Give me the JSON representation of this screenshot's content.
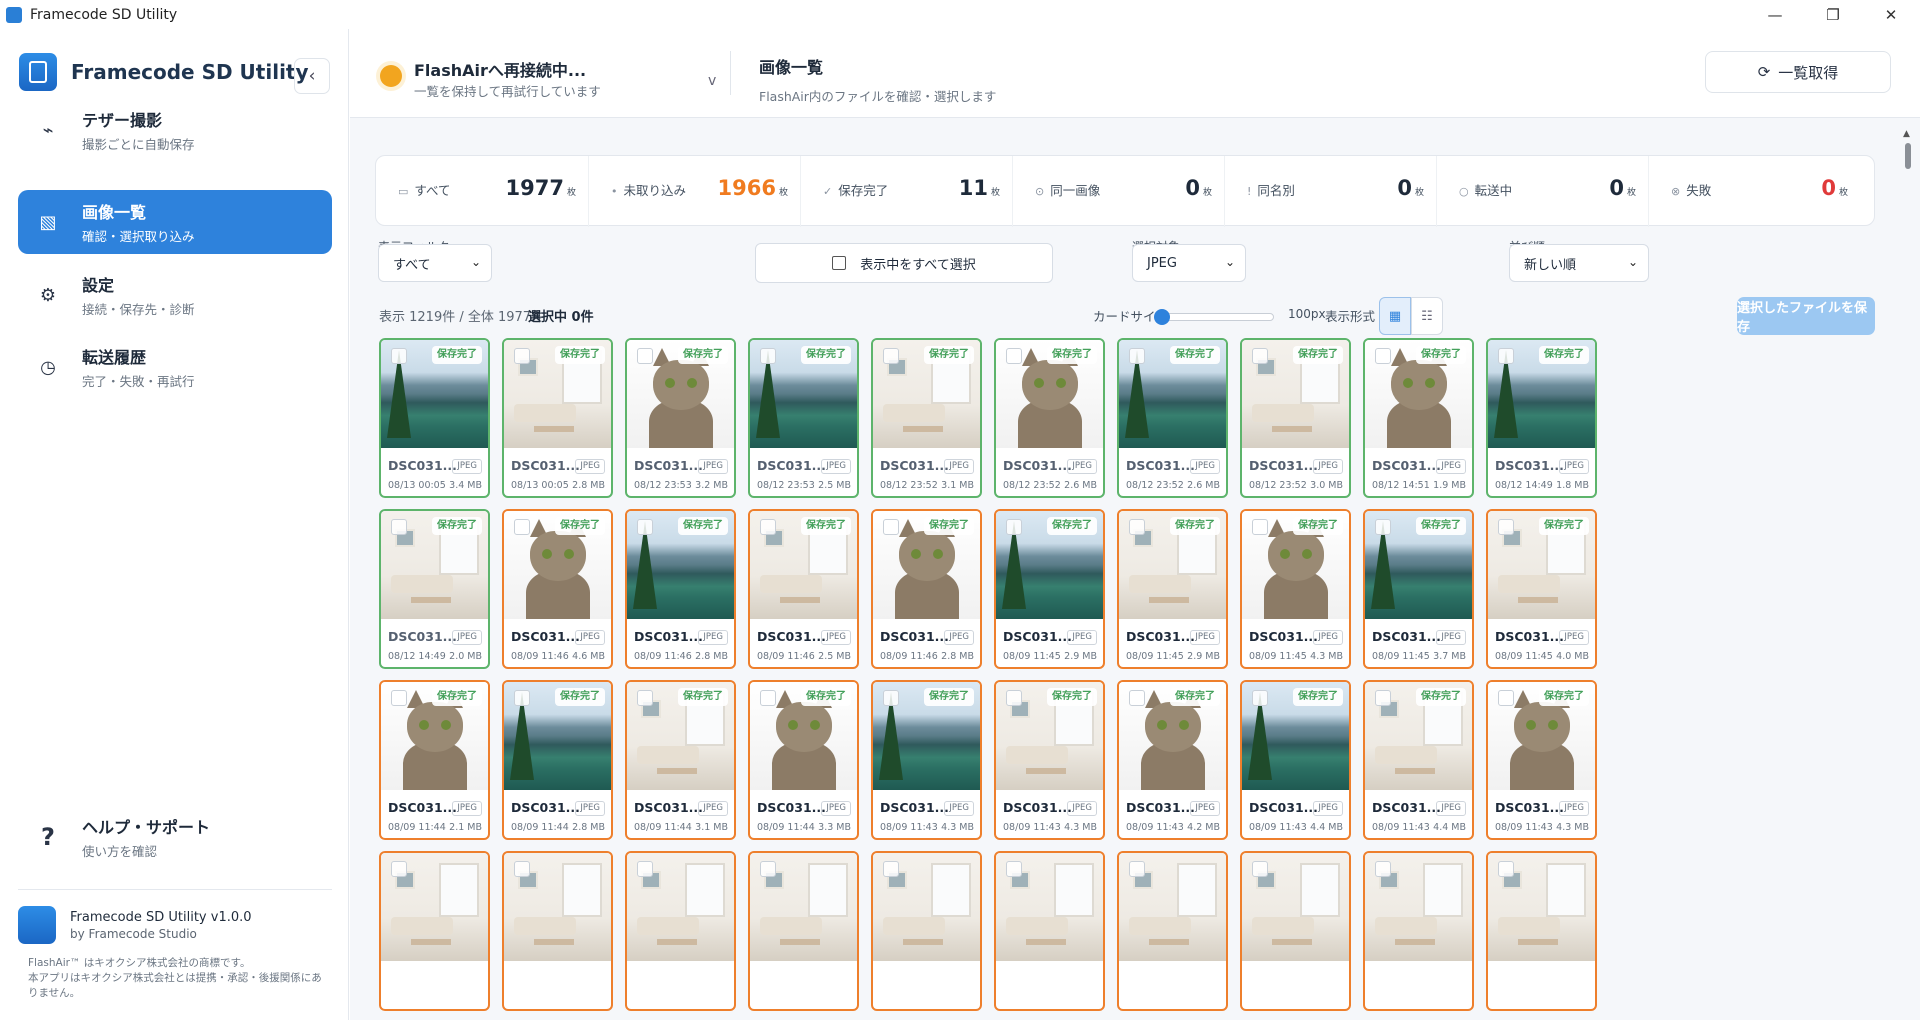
{
  "window": {
    "title": "Framecode SD Utility",
    "controls": [
      "—",
      "❐",
      "✕"
    ]
  },
  "sidebar": {
    "app_name": "Framecode SD Utility",
    "collapse_icon": "‹",
    "nav": [
      {
        "label": "テザー撮影",
        "sub": "撮影ごとに自動保存",
        "icon": "⌁"
      },
      {
        "label": "画像一覧",
        "sub": "確認・選択取り込み",
        "icon": "▧"
      },
      {
        "label": "設定",
        "sub": "接続・保存先・診断",
        "icon": "⚙"
      },
      {
        "label": "転送履歴",
        "sub": "完了・失敗・再試行",
        "icon": "◷"
      }
    ],
    "help": {
      "label": "ヘルプ・サポート",
      "sub": "使い方を確認",
      "icon": "?"
    },
    "footer": {
      "version": "Framecode SD Utility v1.0.0",
      "by": "by Framecode Studio",
      "legal": "FlashAir™ はキオクシア株式会社の商標です。\n本アプリはキオクシア株式会社とは提携・承認・後援関係にありません。"
    }
  },
  "topbar": {
    "conn_title": "FlashAirへ再接続中...",
    "conn_sub": "一覧を保持して再試行しています",
    "conn_chevron": "v",
    "page_title": "画像一覧",
    "page_sub": "FlashAir内のファイルを確認・選択します",
    "refresh_label": "一覧取得",
    "refresh_icon": "⟳"
  },
  "stats": [
    {
      "label": "すべて",
      "icon": "▭",
      "value": "1977",
      "unit": "枚",
      "color": "dark"
    },
    {
      "label": "未取り込み",
      "icon": "•",
      "value": "1966",
      "unit": "枚",
      "color": "orange"
    },
    {
      "label": "保存完了",
      "icon": "✓",
      "value": "11",
      "unit": "枚",
      "color": "dark"
    },
    {
      "label": "同一画像",
      "icon": "⊙",
      "value": "0",
      "unit": "枚",
      "color": "dark"
    },
    {
      "label": "同名別",
      "icon": "!",
      "value": "0",
      "unit": "枚",
      "color": "dark"
    },
    {
      "label": "転送中",
      "icon": "○",
      "value": "0",
      "unit": "枚",
      "color": "dark"
    },
    {
      "label": "失敗",
      "icon": "⊗",
      "value": "0",
      "unit": "枚",
      "color": "red"
    }
  ],
  "filters": {
    "display_filter_label": "表示フィルター",
    "display_filter_value": "すべて",
    "select_all_label": "表示中をすべて選択",
    "target_label": "選択対象",
    "target_value": "JPEG",
    "sort_label": "並び順",
    "sort_value": "新しい順"
  },
  "info": {
    "count": "表示 1219件 / 全体 1977件",
    "selected": "選択中 0件",
    "card_size_label": "カードサイズ",
    "card_size_value": 0.0,
    "card_size_px": "100px",
    "view_mode_label": "表示形式",
    "grid_icon": "▦",
    "list_icon": "☷",
    "save_button": "選択したファイルを保存"
  },
  "cards": [
    {
      "img": "mountain",
      "status": "green",
      "badge": "保存完了",
      "name": "DSC031...",
      "type": "JPEG",
      "date": "08/13 00:05",
      "size": "3.4 MB"
    },
    {
      "img": "room",
      "status": "green",
      "badge": "保存完了",
      "name": "DSC031...",
      "type": "JPEG",
      "date": "08/13 00:05",
      "size": "2.8 MB"
    },
    {
      "img": "cat",
      "status": "green",
      "badge": "保存完了",
      "name": "DSC031...",
      "type": "JPEG",
      "date": "08/12 23:53",
      "size": "3.2 MB"
    },
    {
      "img": "mountain",
      "status": "green",
      "badge": "保存完了",
      "name": "DSC031...",
      "type": "JPEG",
      "date": "08/12 23:53",
      "size": "2.5 MB"
    },
    {
      "img": "room",
      "status": "green",
      "badge": "保存完了",
      "name": "DSC031...",
      "type": "JPEG",
      "date": "08/12 23:52",
      "size": "3.1 MB"
    },
    {
      "img": "cat",
      "status": "green",
      "badge": "保存完了",
      "name": "DSC031...",
      "type": "JPEG",
      "date": "08/12 23:52",
      "size": "2.6 MB"
    },
    {
      "img": "mountain",
      "status": "green",
      "badge": "保存完了",
      "name": "DSC031...",
      "type": "JPEG",
      "date": "08/12 23:52",
      "size": "2.6 MB"
    },
    {
      "img": "room",
      "status": "green",
      "badge": "保存完了",
      "name": "DSC031...",
      "type": "JPEG",
      "date": "08/12 23:52",
      "size": "3.0 MB"
    },
    {
      "img": "cat",
      "status": "green",
      "badge": "保存完了",
      "name": "DSC031...",
      "type": "JPEG",
      "date": "08/12 14:51",
      "size": "1.9 MB"
    },
    {
      "img": "mountain",
      "status": "green",
      "badge": "保存完了",
      "name": "DSC031...",
      "type": "JPEG",
      "date": "08/12 14:49",
      "size": "1.8 MB"
    },
    {
      "img": "room",
      "status": "green",
      "badge": "保存完了",
      "name": "DSC031...",
      "type": "JPEG",
      "date": "08/12 14:49",
      "size": "2.0 MB"
    },
    {
      "img": "cat",
      "status": "orange",
      "badge": "保存完了",
      "name": "DSC031...",
      "type": "JPEG",
      "date": "08/09 11:46",
      "size": "4.6 MB"
    },
    {
      "img": "mountain",
      "status": "orange",
      "badge": "保存完了",
      "name": "DSC031...",
      "type": "JPEG",
      "date": "08/09 11:46",
      "size": "2.8 MB"
    },
    {
      "img": "room",
      "status": "orange",
      "badge": "保存完了",
      "name": "DSC031...",
      "type": "JPEG",
      "date": "08/09 11:46",
      "size": "2.5 MB"
    },
    {
      "img": "cat",
      "status": "orange",
      "badge": "保存完了",
      "name": "DSC031...",
      "type": "JPEG",
      "date": "08/09 11:46",
      "size": "2.8 MB"
    },
    {
      "img": "mountain",
      "status": "orange",
      "badge": "保存完了",
      "name": "DSC031...",
      "type": "JPEG",
      "date": "08/09 11:45",
      "size": "2.9 MB"
    },
    {
      "img": "room",
      "status": "orange",
      "badge": "保存完了",
      "name": "DSC031...",
      "type": "JPEG",
      "date": "08/09 11:45",
      "size": "2.9 MB"
    },
    {
      "img": "cat",
      "status": "orange",
      "badge": "保存完了",
      "name": "DSC031...",
      "type": "JPEG",
      "date": "08/09 11:45",
      "size": "4.3 MB"
    },
    {
      "img": "mountain",
      "status": "orange",
      "badge": "保存完了",
      "name": "DSC031...",
      "type": "JPEG",
      "date": "08/09 11:45",
      "size": "3.7 MB"
    },
    {
      "img": "room",
      "status": "orange",
      "badge": "保存完了",
      "name": "DSC031...",
      "type": "JPEG",
      "date": "08/09 11:45",
      "size": "4.0 MB"
    },
    {
      "img": "cat",
      "status": "orange",
      "badge": "保存完了",
      "name": "DSC031...",
      "type": "JPEG",
      "date": "08/09 11:44",
      "size": "2.1 MB"
    },
    {
      "img": "mountain",
      "status": "orange",
      "badge": "保存完了",
      "name": "DSC031...",
      "type": "JPEG",
      "date": "08/09 11:44",
      "size": "2.8 MB"
    },
    {
      "img": "room",
      "status": "orange",
      "badge": "保存完了",
      "name": "DSC031...",
      "type": "JPEG",
      "date": "08/09 11:44",
      "size": "3.1 MB"
    },
    {
      "img": "cat",
      "status": "orange",
      "badge": "保存完了",
      "name": "DSC031...",
      "type": "JPEG",
      "date": "08/09 11:44",
      "size": "3.3 MB"
    },
    {
      "img": "mountain",
      "status": "orange",
      "badge": "保存完了",
      "name": "DSC031...",
      "type": "JPEG",
      "date": "08/09 11:43",
      "size": "4.3 MB"
    },
    {
      "img": "room",
      "status": "orange",
      "badge": "保存完了",
      "name": "DSC031...",
      "type": "JPEG",
      "date": "08/09 11:43",
      "size": "4.3 MB"
    },
    {
      "img": "cat",
      "status": "orange",
      "badge": "保存完了",
      "name": "DSC031...",
      "type": "JPEG",
      "date": "08/09 11:43",
      "size": "4.2 MB"
    },
    {
      "img": "mountain",
      "status": "orange",
      "badge": "保存完了",
      "name": "DSC031...",
      "type": "JPEG",
      "date": "08/09 11:43",
      "size": "4.4 MB"
    },
    {
      "img": "room",
      "status": "orange",
      "badge": "保存完了",
      "name": "DSC031...",
      "type": "JPEG",
      "date": "08/09 11:43",
      "size": "4.4 MB"
    },
    {
      "img": "cat",
      "status": "orange",
      "badge": "保存完了",
      "name": "DSC031...",
      "type": "JPEG",
      "date": "08/09 11:43",
      "size": "4.3 MB"
    },
    {
      "img": "room",
      "status": "orange",
      "badge": "",
      "name": "",
      "type": "",
      "date": "",
      "size": ""
    },
    {
      "img": "room",
      "status": "orange",
      "badge": "",
      "name": "",
      "type": "",
      "date": "",
      "size": ""
    },
    {
      "img": "room",
      "status": "orange",
      "badge": "",
      "name": "",
      "type": "",
      "date": "",
      "size": ""
    },
    {
      "img": "room",
      "status": "orange",
      "badge": "",
      "name": "",
      "type": "",
      "date": "",
      "size": ""
    },
    {
      "img": "room",
      "status": "orange",
      "badge": "",
      "name": "",
      "type": "",
      "date": "",
      "size": ""
    },
    {
      "img": "room",
      "status": "orange",
      "badge": "",
      "name": "",
      "type": "",
      "date": "",
      "size": ""
    },
    {
      "img": "room",
      "status": "orange",
      "badge": "",
      "name": "",
      "type": "",
      "date": "",
      "size": ""
    },
    {
      "img": "room",
      "status": "orange",
      "badge": "",
      "name": "",
      "type": "",
      "date": "",
      "size": ""
    },
    {
      "img": "room",
      "status": "orange",
      "badge": "",
      "name": "",
      "type": "",
      "date": "",
      "size": ""
    },
    {
      "img": "room",
      "status": "orange",
      "badge": "",
      "name": "",
      "type": "",
      "date": "",
      "size": ""
    }
  ],
  "colors": {
    "accent": "#2e82dc",
    "saved": "#5db46b",
    "pending": "#ee7f2c",
    "warning": "#f2a51f",
    "error": "#e03a3a"
  }
}
